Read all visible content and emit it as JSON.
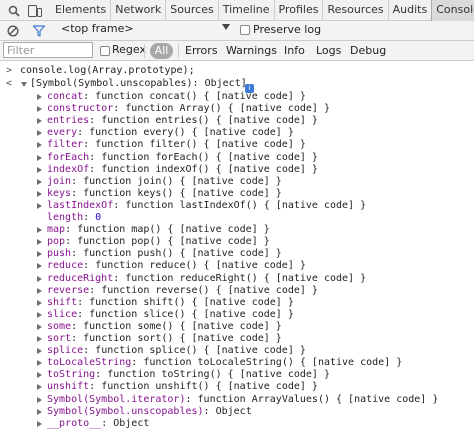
{
  "tabbar": {
    "tabs": [
      {
        "label": "Elements"
      },
      {
        "label": "Network"
      },
      {
        "label": "Sources"
      },
      {
        "label": "Timeline"
      },
      {
        "label": "Profiles"
      },
      {
        "label": "Resources"
      },
      {
        "label": "Audits"
      },
      {
        "label": "Console",
        "active": true
      }
    ]
  },
  "toolbar": {
    "frame_select": "<top frame>",
    "preserve_log_label": "Preserve log",
    "filter_placeholder": "Filter",
    "regex_label": "Regex",
    "all_label": "All",
    "levels": [
      "Errors",
      "Warnings",
      "Info",
      "Logs",
      "Debug"
    ]
  },
  "console": {
    "input": "console.log(Array.prototype);",
    "object_header": "[Symbol(Symbol.unscopables): Object]",
    "entries": [
      {
        "key": "concat",
        "value": "function concat() { [native code] }"
      },
      {
        "key": "constructor",
        "value": "function Array() { [native code] }"
      },
      {
        "key": "entries",
        "value": "function entries() { [native code] }"
      },
      {
        "key": "every",
        "value": "function every() { [native code] }"
      },
      {
        "key": "filter",
        "value": "function filter() { [native code] }"
      },
      {
        "key": "forEach",
        "value": "function forEach() { [native code] }"
      },
      {
        "key": "indexOf",
        "value": "function indexOf() { [native code] }"
      },
      {
        "key": "join",
        "value": "function join() { [native code] }"
      },
      {
        "key": "keys",
        "value": "function keys() { [native code] }"
      },
      {
        "key": "lastIndexOf",
        "value": "function lastIndexOf() { [native code] }"
      },
      {
        "key": "length",
        "value": "0",
        "leaf": true
      },
      {
        "key": "map",
        "value": "function map() { [native code] }"
      },
      {
        "key": "pop",
        "value": "function pop() { [native code] }"
      },
      {
        "key": "push",
        "value": "function push() { [native code] }"
      },
      {
        "key": "reduce",
        "value": "function reduce() { [native code] }"
      },
      {
        "key": "reduceRight",
        "value": "function reduceRight() { [native code] }"
      },
      {
        "key": "reverse",
        "value": "function reverse() { [native code] }"
      },
      {
        "key": "shift",
        "value": "function shift() { [native code] }"
      },
      {
        "key": "slice",
        "value": "function slice() { [native code] }"
      },
      {
        "key": "some",
        "value": "function some() { [native code] }"
      },
      {
        "key": "sort",
        "value": "function sort() { [native code] }"
      },
      {
        "key": "splice",
        "value": "function splice() { [native code] }"
      },
      {
        "key": "toLocaleString",
        "value": "function toLocaleString() { [native code] }"
      },
      {
        "key": "toString",
        "value": "function toString() { [native code] }"
      },
      {
        "key": "unshift",
        "value": "function unshift() { [native code] }"
      },
      {
        "key": "Symbol(Symbol.iterator)",
        "value": "function ArrayValues() { [native code] }"
      },
      {
        "key": "Symbol(Symbol.unscopables)",
        "value": "Object"
      },
      {
        "key": "__proto__",
        "value": "Object"
      }
    ]
  },
  "colors": {
    "key": "#881391",
    "number": "#1c00cf",
    "text": "#222222",
    "info_icon": "#3c7ad8",
    "all_button": "#a8a8a8"
  }
}
